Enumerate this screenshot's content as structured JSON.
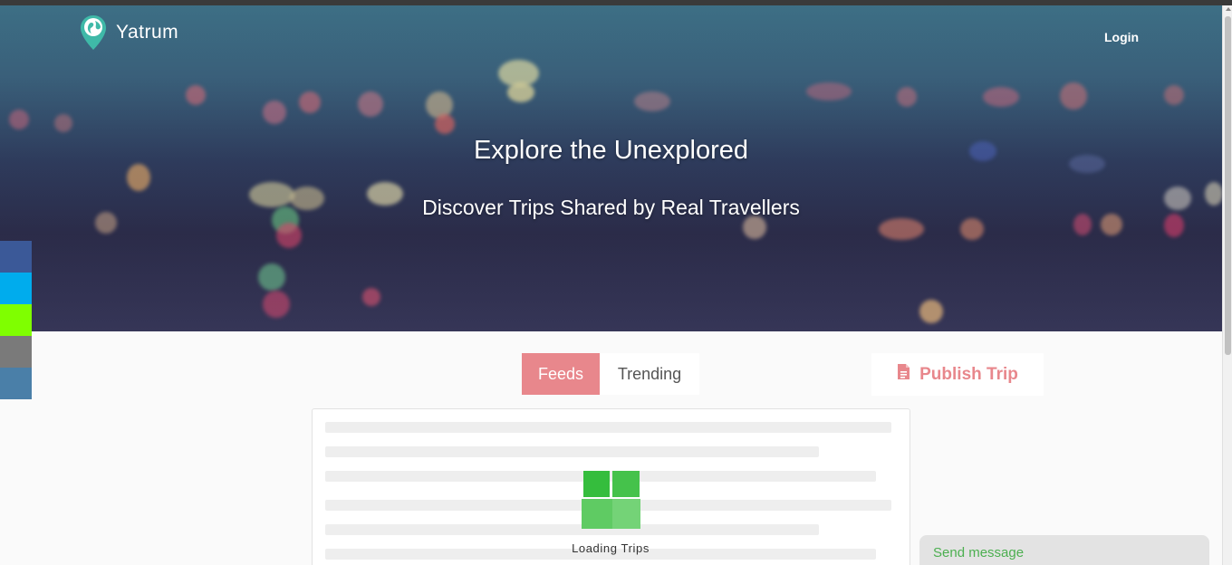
{
  "header": {
    "brand_name": "Yatrum",
    "login_label": "Login"
  },
  "hero": {
    "title": "Explore the Unexplored",
    "subtitle": "Discover Trips Shared by Real Travellers"
  },
  "social_bar": {
    "items": [
      {
        "icon": "facebook-icon",
        "color": "#3b5998"
      },
      {
        "icon": "twitter-icon",
        "color": "#00aced"
      },
      {
        "icon": "share-icon",
        "color": "#7fff00"
      },
      {
        "icon": "email-icon",
        "color": "#7a7a7a"
      },
      {
        "icon": "more-icon",
        "color": "#4a7fa8"
      }
    ]
  },
  "tabs": [
    {
      "label": "Feeds",
      "active": true
    },
    {
      "label": "Trending",
      "active": false
    }
  ],
  "publish_button": {
    "label": "Publish Trip",
    "icon": "document-icon"
  },
  "loader": {
    "text": "Loading Trips"
  },
  "chat": {
    "label": "Send message"
  },
  "colors": {
    "accent": "#e8878c",
    "loader_green": "#3dbf45",
    "chat_text": "#4caf50"
  }
}
